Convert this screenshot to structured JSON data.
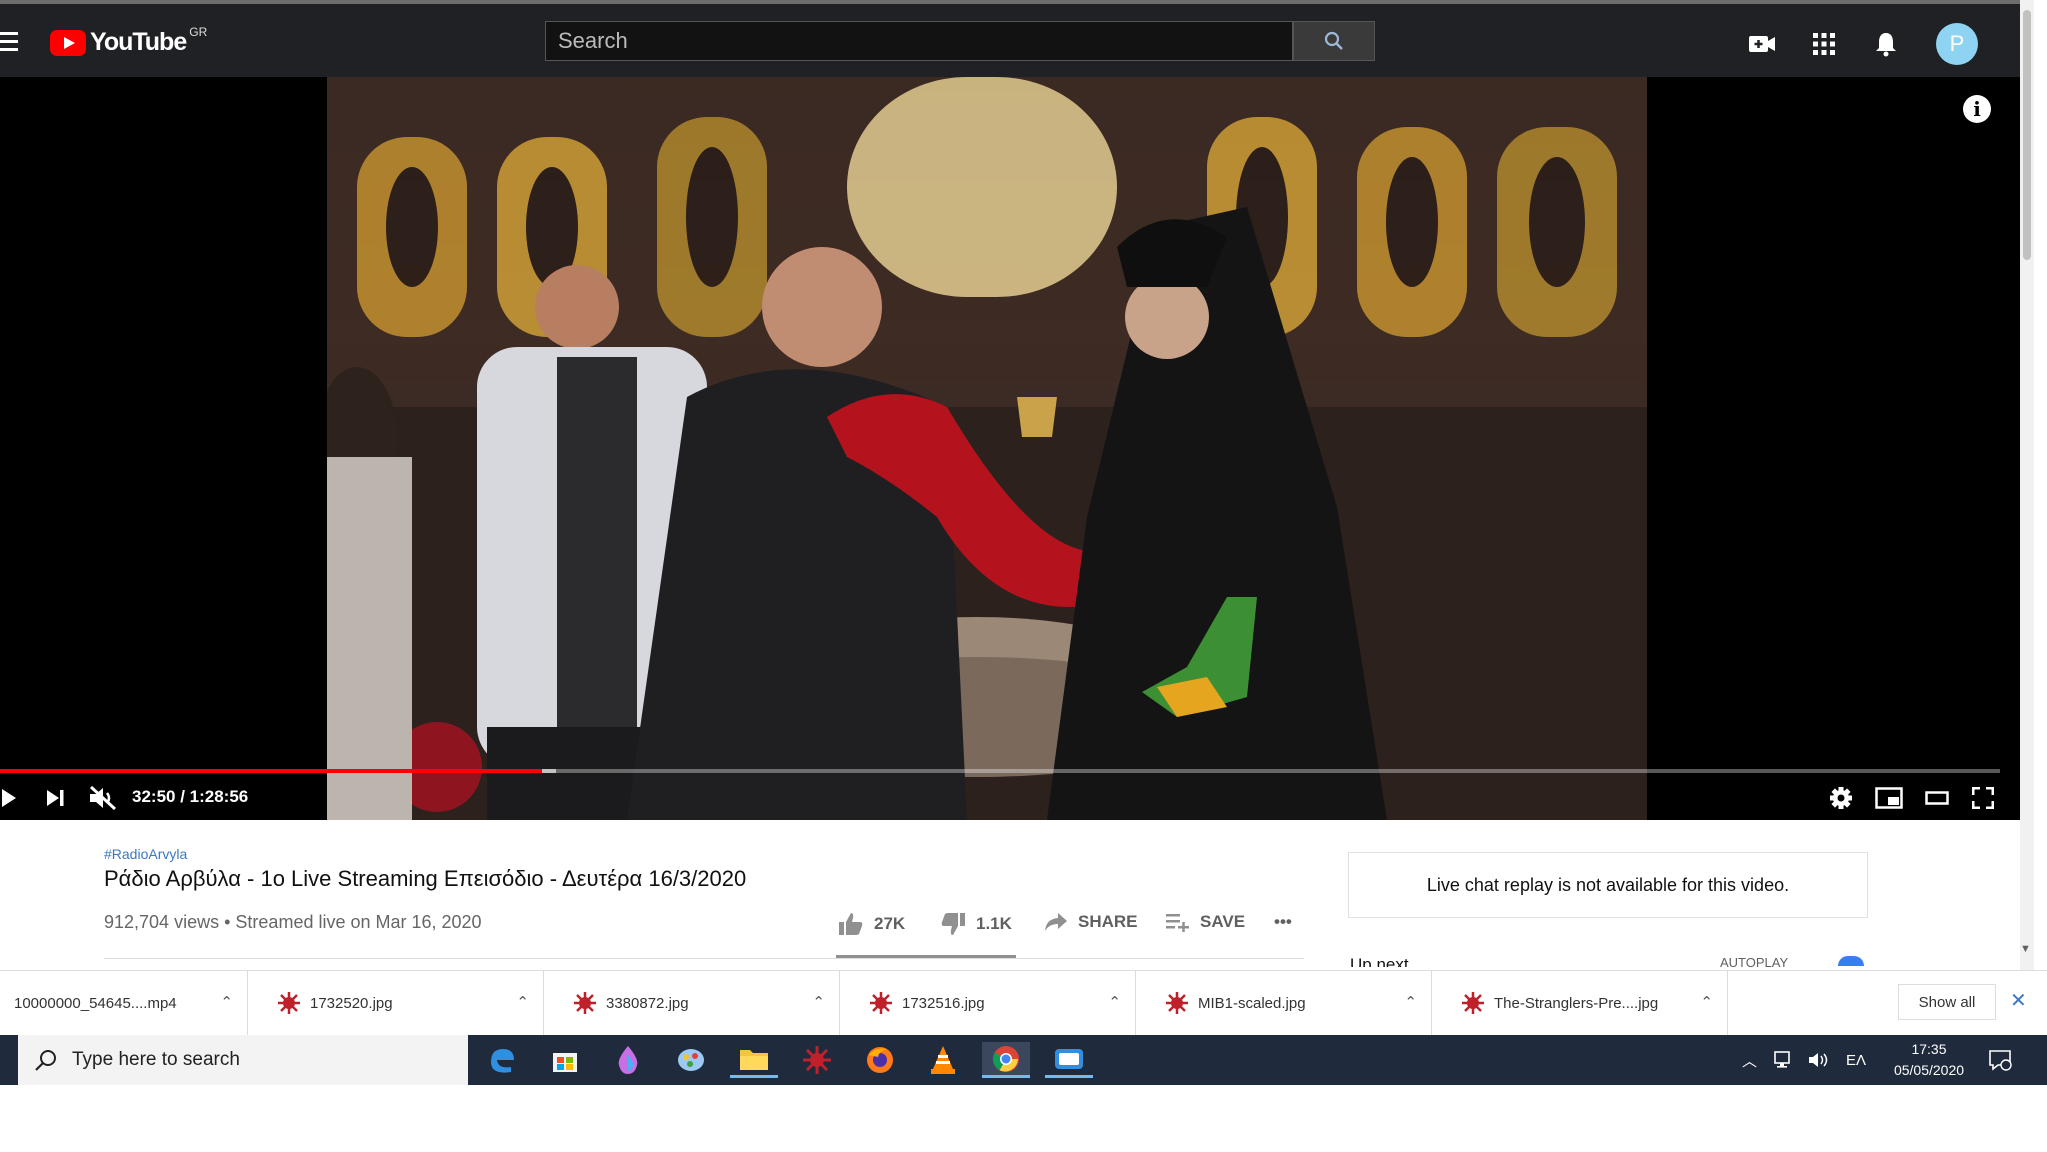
{
  "header": {
    "logo_text": "YouTube",
    "country_code": "GR",
    "search_placeholder": "Search",
    "avatar_letter": "P"
  },
  "player": {
    "time_display": "32:50 / 1:28:56",
    "progress_fraction": 0.271,
    "buffer_fraction": 0.278
  },
  "video": {
    "hashtag": "#RadioArvyla",
    "title": "Ράδιο Αρβύλα - 1ο Live Streaming Επεισόδιο - Δευτέρα 16/3/2020",
    "views": "912,704 views",
    "separator": "•",
    "streamed": "Streamed live on Mar 16, 2020",
    "likes": "27K",
    "dislikes": "1.1K",
    "share_label": "SHARE",
    "save_label": "SAVE",
    "more_label": "•••"
  },
  "sidebar": {
    "chat_notice": "Live chat replay is not available for this video.",
    "up_next": "Up next",
    "autoplay": "AUTOPLAY"
  },
  "downloads": {
    "items": [
      {
        "name": "10000000_54645....mp4"
      },
      {
        "name": "1732520.jpg"
      },
      {
        "name": "3380872.jpg"
      },
      {
        "name": "1732516.jpg"
      },
      {
        "name": "MIB1-scaled.jpg"
      },
      {
        "name": "The-Stranglers-Pre....jpg"
      }
    ],
    "show_all": "Show all"
  },
  "taskbar": {
    "search_placeholder": "Type here to search",
    "language": "ΕΛ",
    "time": "17:35",
    "date": "05/05/2020",
    "apps": [
      "edge-icon",
      "store-icon",
      "paint-3d-icon",
      "photos-icon",
      "file-explorer-icon",
      "app-icon",
      "firefox-icon",
      "vlc-icon",
      "chrome-icon",
      "mail-icon"
    ]
  },
  "colors": {
    "youtube_red": "#ff0000",
    "topbar_bg": "#202124",
    "link_blue": "#3a78c3",
    "taskbar_bg": "#1f2a3d"
  }
}
